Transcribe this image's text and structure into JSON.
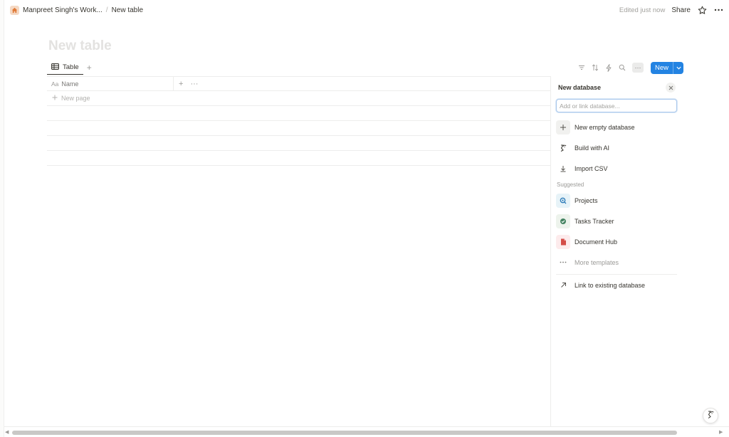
{
  "breadcrumb": {
    "workspace": "Manpreet Singh's Work...",
    "separator": "/",
    "page": "New table"
  },
  "topbar": {
    "edited": "Edited just now",
    "share": "Share"
  },
  "page": {
    "title": "New table"
  },
  "view": {
    "tab_label": "Table",
    "add_view": "+",
    "more": "···",
    "new_label": "New"
  },
  "table": {
    "name_prefix": "Aa",
    "name_header": "Name",
    "add_property": "+",
    "more": "···",
    "new_page": "New page"
  },
  "panel": {
    "title": "New database",
    "input_placeholder": "Add or link database...",
    "actions": [
      {
        "label": "New empty database",
        "icon": "plus-icon"
      },
      {
        "label": "Build with AI",
        "icon": "ai-face-icon"
      },
      {
        "label": "Import CSV",
        "icon": "download-icon"
      }
    ],
    "suggested_label": "Suggested",
    "templates": [
      {
        "label": "Projects",
        "icon": "projects-icon",
        "bg": "#e7f3f8",
        "color": "#2b7ab8"
      },
      {
        "label": "Tasks Tracker",
        "icon": "check-circle-icon",
        "bg": "#edf3ec",
        "color": "#448361"
      },
      {
        "label": "Document Hub",
        "icon": "document-icon",
        "bg": "#fdebec",
        "color": "#d44c47"
      }
    ],
    "more_templates": "More templates",
    "link_existing": "Link to existing database"
  },
  "colors": {
    "accent": "#2383e2",
    "home_icon": "#e07b39"
  }
}
